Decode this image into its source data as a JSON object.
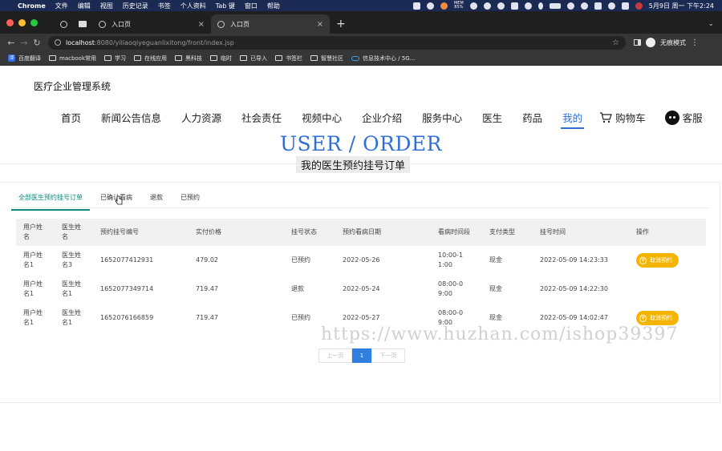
{
  "os_menu": {
    "app": "Chrome",
    "items": [
      "文件",
      "编辑",
      "视图",
      "历史记录",
      "书签",
      "个人资料",
      "Tab 键",
      "窗口",
      "帮助"
    ],
    "clock": "5月9日 周一 下午2:24",
    "mem_label": "MEM",
    "mem_value": "85%"
  },
  "browser": {
    "tabs": [
      {
        "title": ""
      },
      {
        "title": "入口页"
      },
      {
        "title": "入口页"
      }
    ],
    "url_host": "localhost",
    "url_path": ":8080/yiliaoqiyeguanlixitong/front/index.jsp",
    "profile": "无痕模式",
    "bookmarks": [
      "百度翻译",
      "macbook常用",
      "学习",
      "在线应用",
      "黑科技",
      "临时",
      "已导入",
      "书签栏",
      "智慧社区",
      "信息技术中心 / 5G..."
    ]
  },
  "site": {
    "title": "医疗企业管理系统",
    "nav": [
      "首页",
      "新闻公告信息",
      "人力资源",
      "社会责任",
      "视频中心",
      "企业介绍",
      "服务中心",
      "医生",
      "药品",
      "我的"
    ],
    "nav_active": "我的",
    "cart": "购物车",
    "service": "客服"
  },
  "hero": {
    "title": "USER / ORDER",
    "subtitle": "我的医生预约挂号订单"
  },
  "sub_tabs": [
    "全部医生预约挂号订单",
    "已确认看病",
    "退款",
    "已预约"
  ],
  "table": {
    "headers": [
      "用户姓名",
      "医生姓名",
      "预约挂号编号",
      "实付价格",
      "挂号状态",
      "预约看病日期",
      "看病时间段",
      "支付类型",
      "挂号时间",
      "操作"
    ],
    "rows": [
      {
        "user": "用户姓名1",
        "doctor": "医生姓名3",
        "code": "1652077412931",
        "price": "479.02",
        "status": "已预约",
        "date": "2022-05-26",
        "slot": "10:00-11:00",
        "pay": "现金",
        "time": "2022-05-09 14:23:33",
        "action": "取消预约"
      },
      {
        "user": "用户姓名1",
        "doctor": "医生姓名1",
        "code": "1652077349714",
        "price": "719.47",
        "status": "退款",
        "date": "2022-05-24",
        "slot": "08:00-09:00",
        "pay": "现金",
        "time": "2022-05-09 14:22:30",
        "action": ""
      },
      {
        "user": "用户姓名1",
        "doctor": "医生姓名1",
        "code": "1652076166859",
        "price": "719.47",
        "status": "已预约",
        "date": "2022-05-27",
        "slot": "08:00-09:00",
        "pay": "现金",
        "time": "2022-05-09 14:02:47",
        "action": "取消预约"
      }
    ]
  },
  "pager": {
    "prev": "上一页",
    "current": "1",
    "next": "下一页"
  },
  "watermark": "https://www.huzhan.com/ishop39397"
}
